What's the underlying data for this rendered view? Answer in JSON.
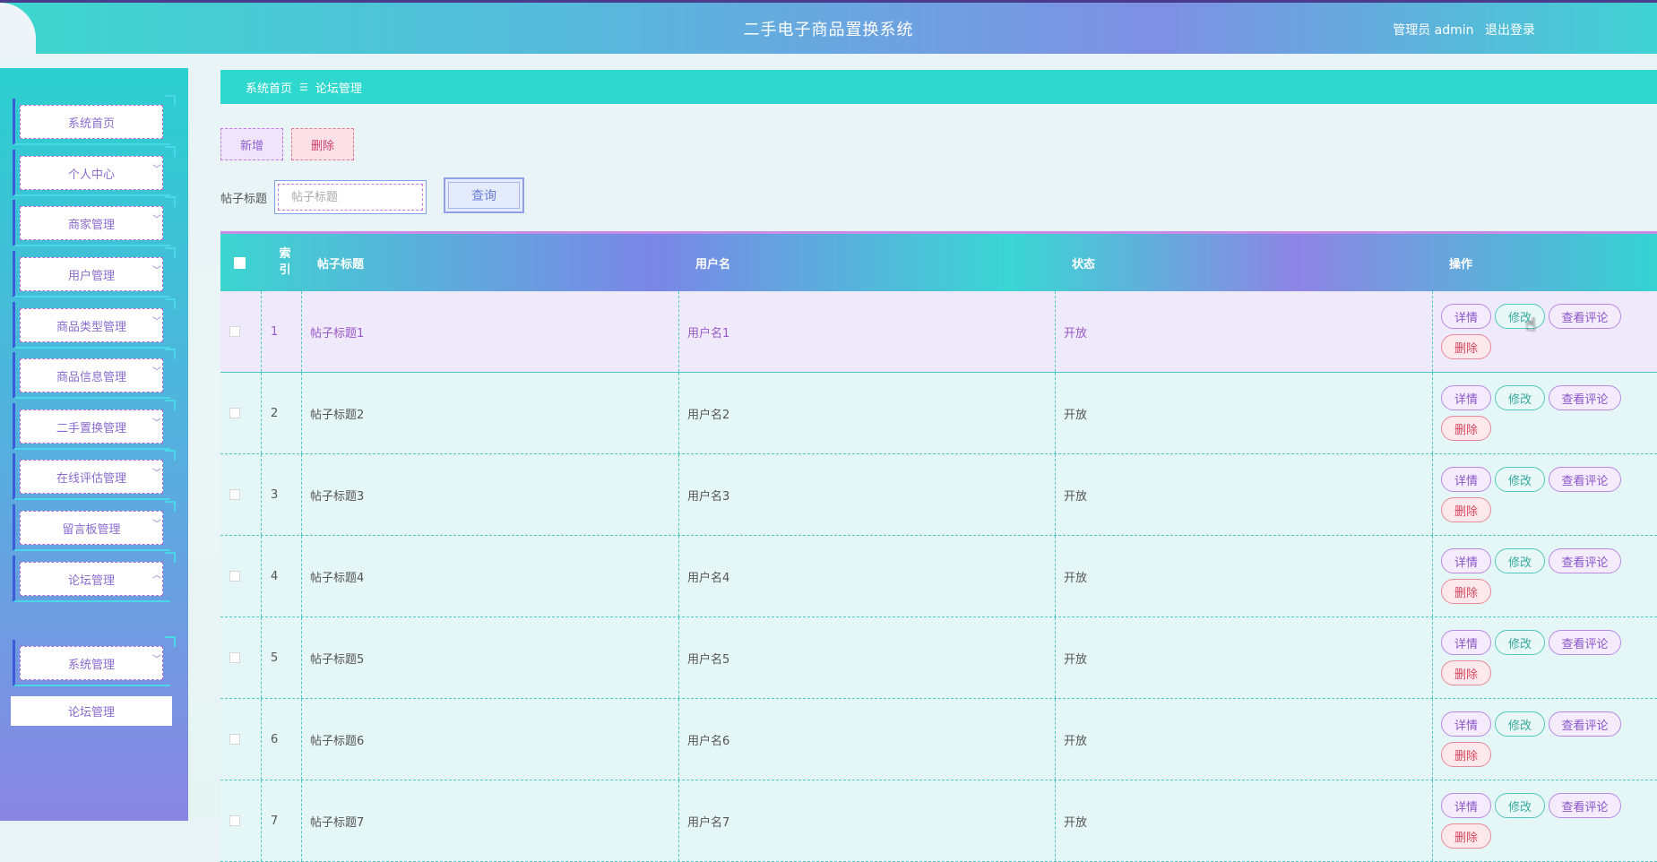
{
  "header": {
    "title": "二手电子商品置换系统",
    "user_label": "管理员 admin",
    "logout_label": "退出登录"
  },
  "sidebar": {
    "items": [
      {
        "label": "系统首页",
        "chevron": ""
      },
      {
        "label": "个人中心",
        "chevron": "chevron-down-icon"
      },
      {
        "label": "商家管理",
        "chevron": "chevron-down-icon"
      },
      {
        "label": "用户管理",
        "chevron": "chevron-down-icon"
      },
      {
        "label": "商品类型管理",
        "chevron": "chevron-down-icon"
      },
      {
        "label": "商品信息管理",
        "chevron": "chevron-down-icon"
      },
      {
        "label": "二手置换管理",
        "chevron": "chevron-down-icon"
      },
      {
        "label": "在线评估管理",
        "chevron": "chevron-down-icon"
      },
      {
        "label": "留言板管理",
        "chevron": "chevron-down-icon"
      },
      {
        "label": "论坛管理",
        "chevron": "chevron-up-icon"
      },
      {
        "label": "系统管理",
        "chevron": "chevron-down-icon"
      }
    ],
    "submenu_label": "论坛管理"
  },
  "breadcrumb": {
    "home": "系统首页",
    "separator": "☰",
    "current": "论坛管理"
  },
  "toolbar": {
    "add_label": "新增",
    "delete_label": "删除"
  },
  "search": {
    "label": "帖子标题",
    "placeholder": "帖子标题",
    "query_label": "查询"
  },
  "table": {
    "columns": [
      "索引",
      "帖子标题",
      "用户名",
      "状态",
      "操作"
    ],
    "rows": [
      {
        "index": "1",
        "title": "帖子标题1",
        "username": "用户名1",
        "status": "开放"
      },
      {
        "index": "2",
        "title": "帖子标题2",
        "username": "用户名2",
        "status": "开放"
      },
      {
        "index": "3",
        "title": "帖子标题3",
        "username": "用户名3",
        "status": "开放"
      },
      {
        "index": "4",
        "title": "帖子标题4",
        "username": "用户名4",
        "status": "开放"
      },
      {
        "index": "5",
        "title": "帖子标题5",
        "username": "用户名5",
        "status": "开放"
      },
      {
        "index": "6",
        "title": "帖子标题6",
        "username": "用户名6",
        "status": "开放"
      },
      {
        "index": "7",
        "title": "帖子标题7",
        "username": "用户名7",
        "status": "开放"
      }
    ],
    "actions": {
      "detail": "详情",
      "edit": "修改",
      "comments": "查看评论",
      "delete": "删除"
    }
  },
  "colors": {
    "accent_teal": "#2fd8cf",
    "accent_purple": "#8a6bd0"
  }
}
